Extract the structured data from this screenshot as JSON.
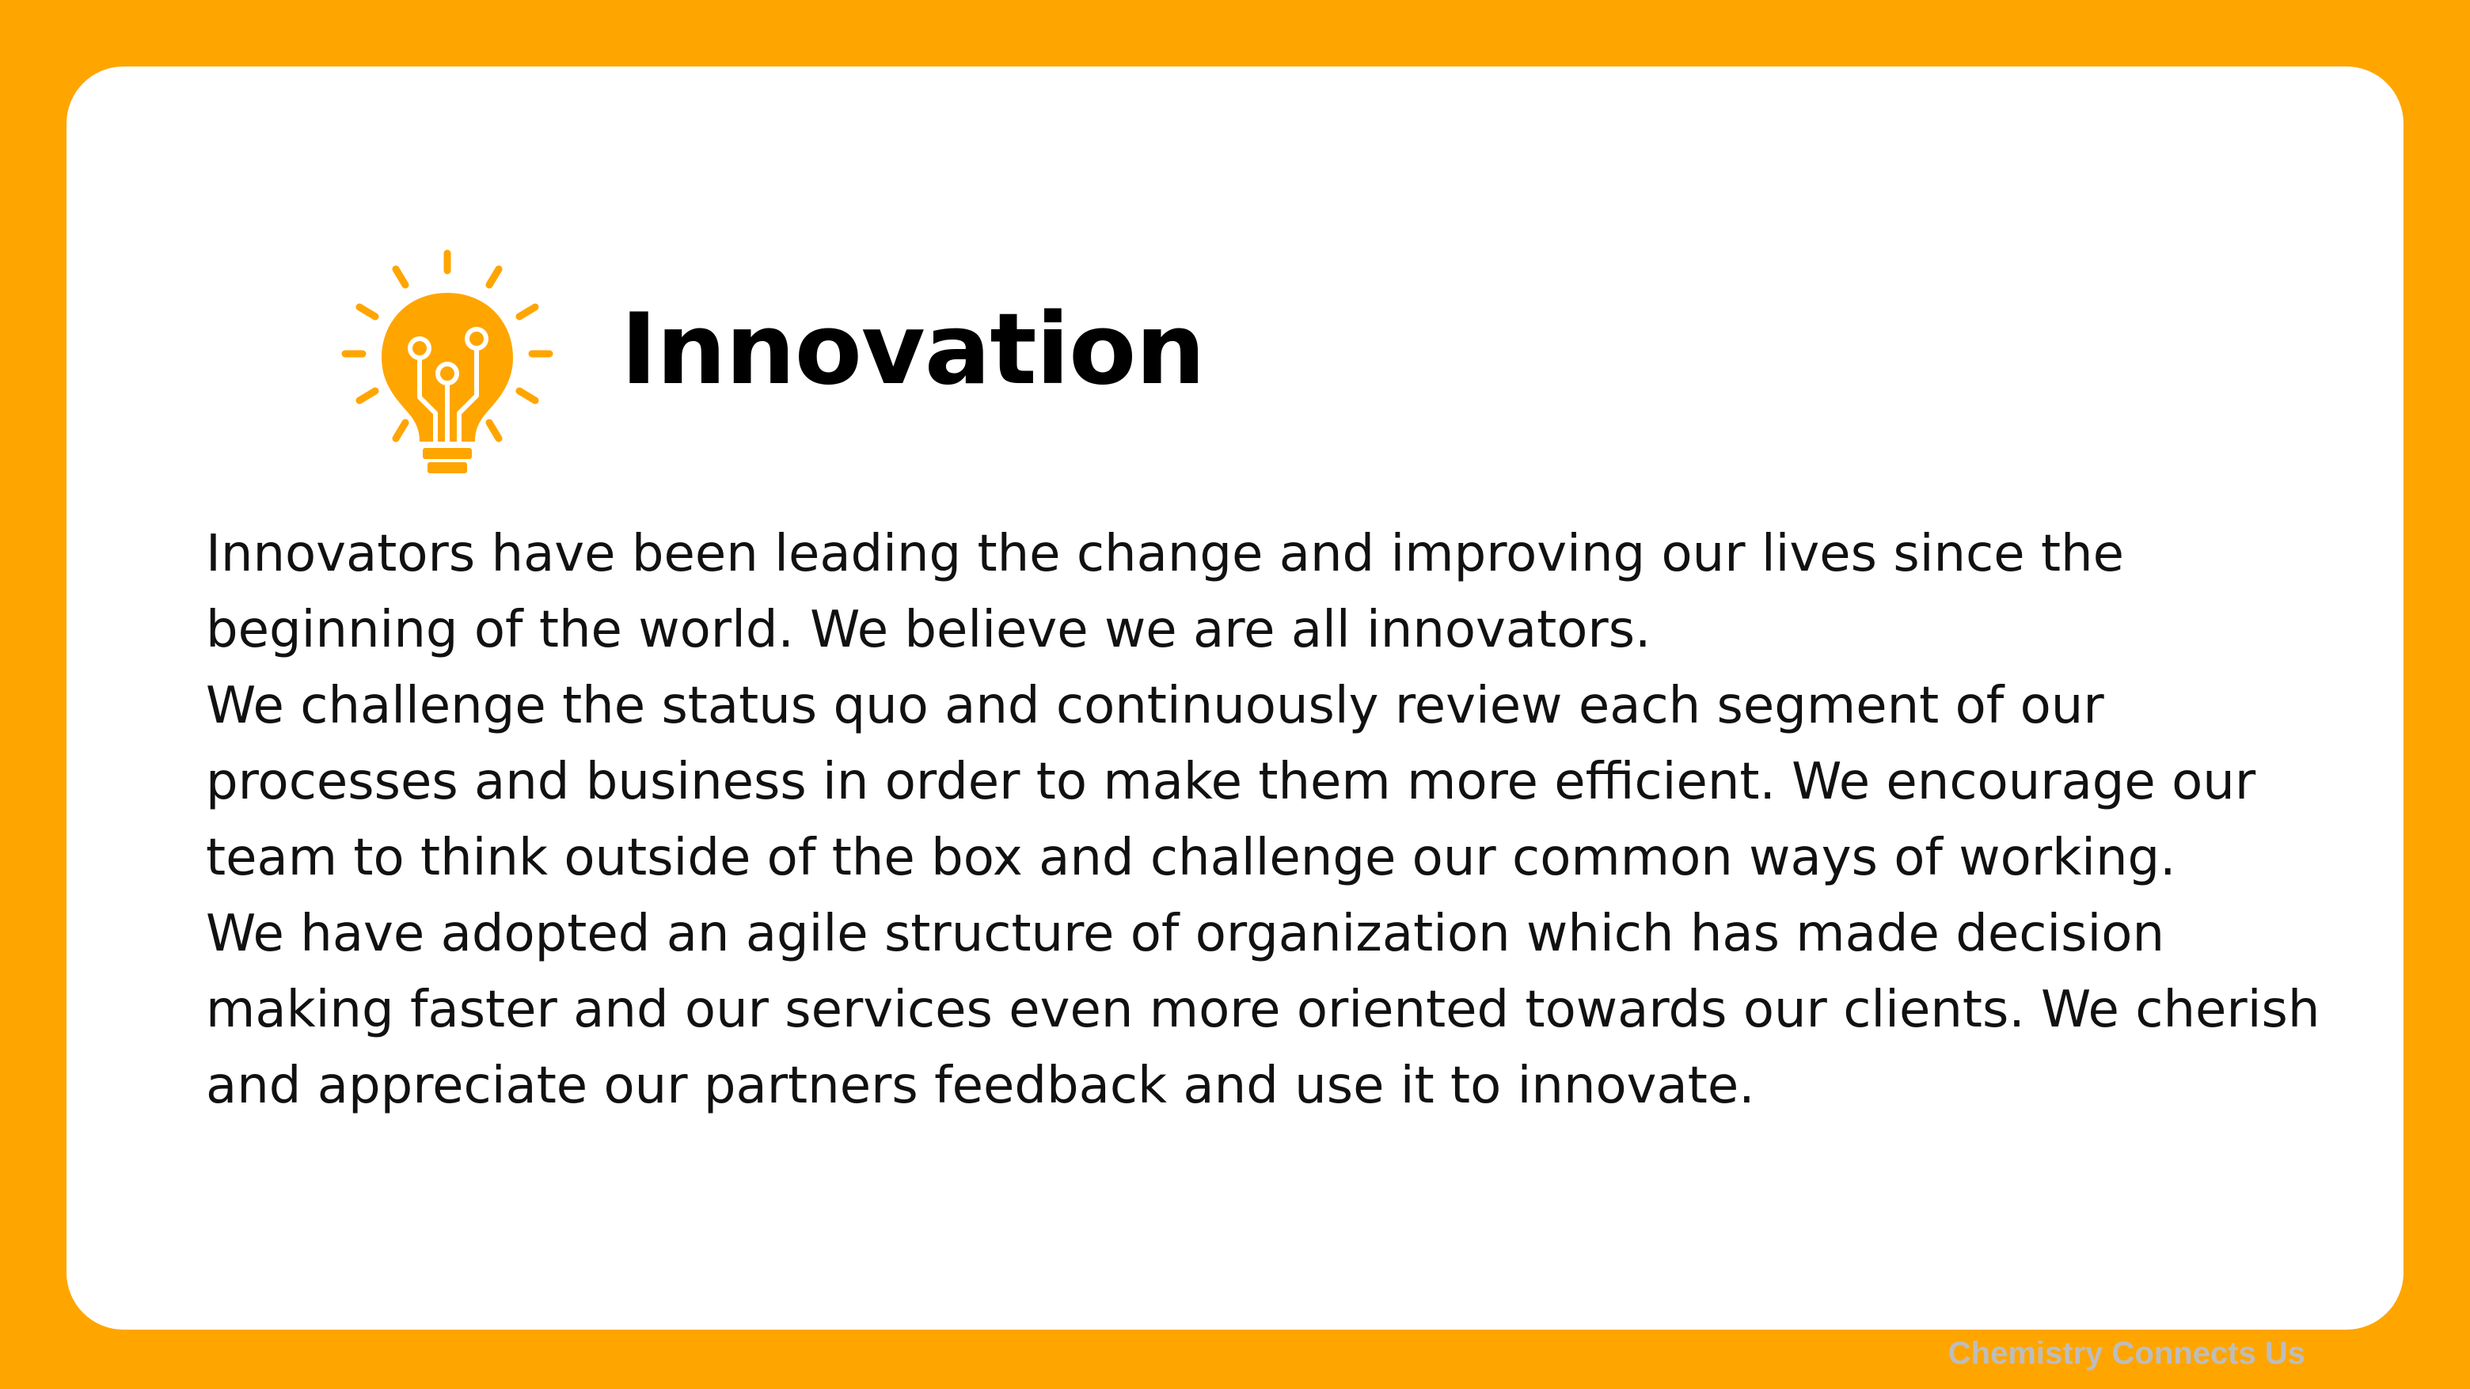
{
  "colors": {
    "background": "#FFA500",
    "card": "#FFFFFF",
    "accent": "#FFA500",
    "title": "#000000",
    "body": "#111111",
    "footer": "#BDBDBD"
  },
  "icon": "lightbulb-circuit-icon",
  "title": "Innovation",
  "body": {
    "lines": [
      "Innovators have been leading the change and improving our lives since the",
      "beginning of the world. We believe we are all innovators.",
      "We challenge the status quo and continuously review each segment of our",
      "processes and business in order to make them more efficient. We encourage our",
      "team to think outside of the box and challenge our common ways of working.",
      "We have adopted an agile structure of organization which has made decision",
      "making faster and our services even more oriented towards our clients. We cherish",
      "and appreciate our partners feedback and use it to innovate."
    ]
  },
  "footer": "Chemistry Connects Us"
}
